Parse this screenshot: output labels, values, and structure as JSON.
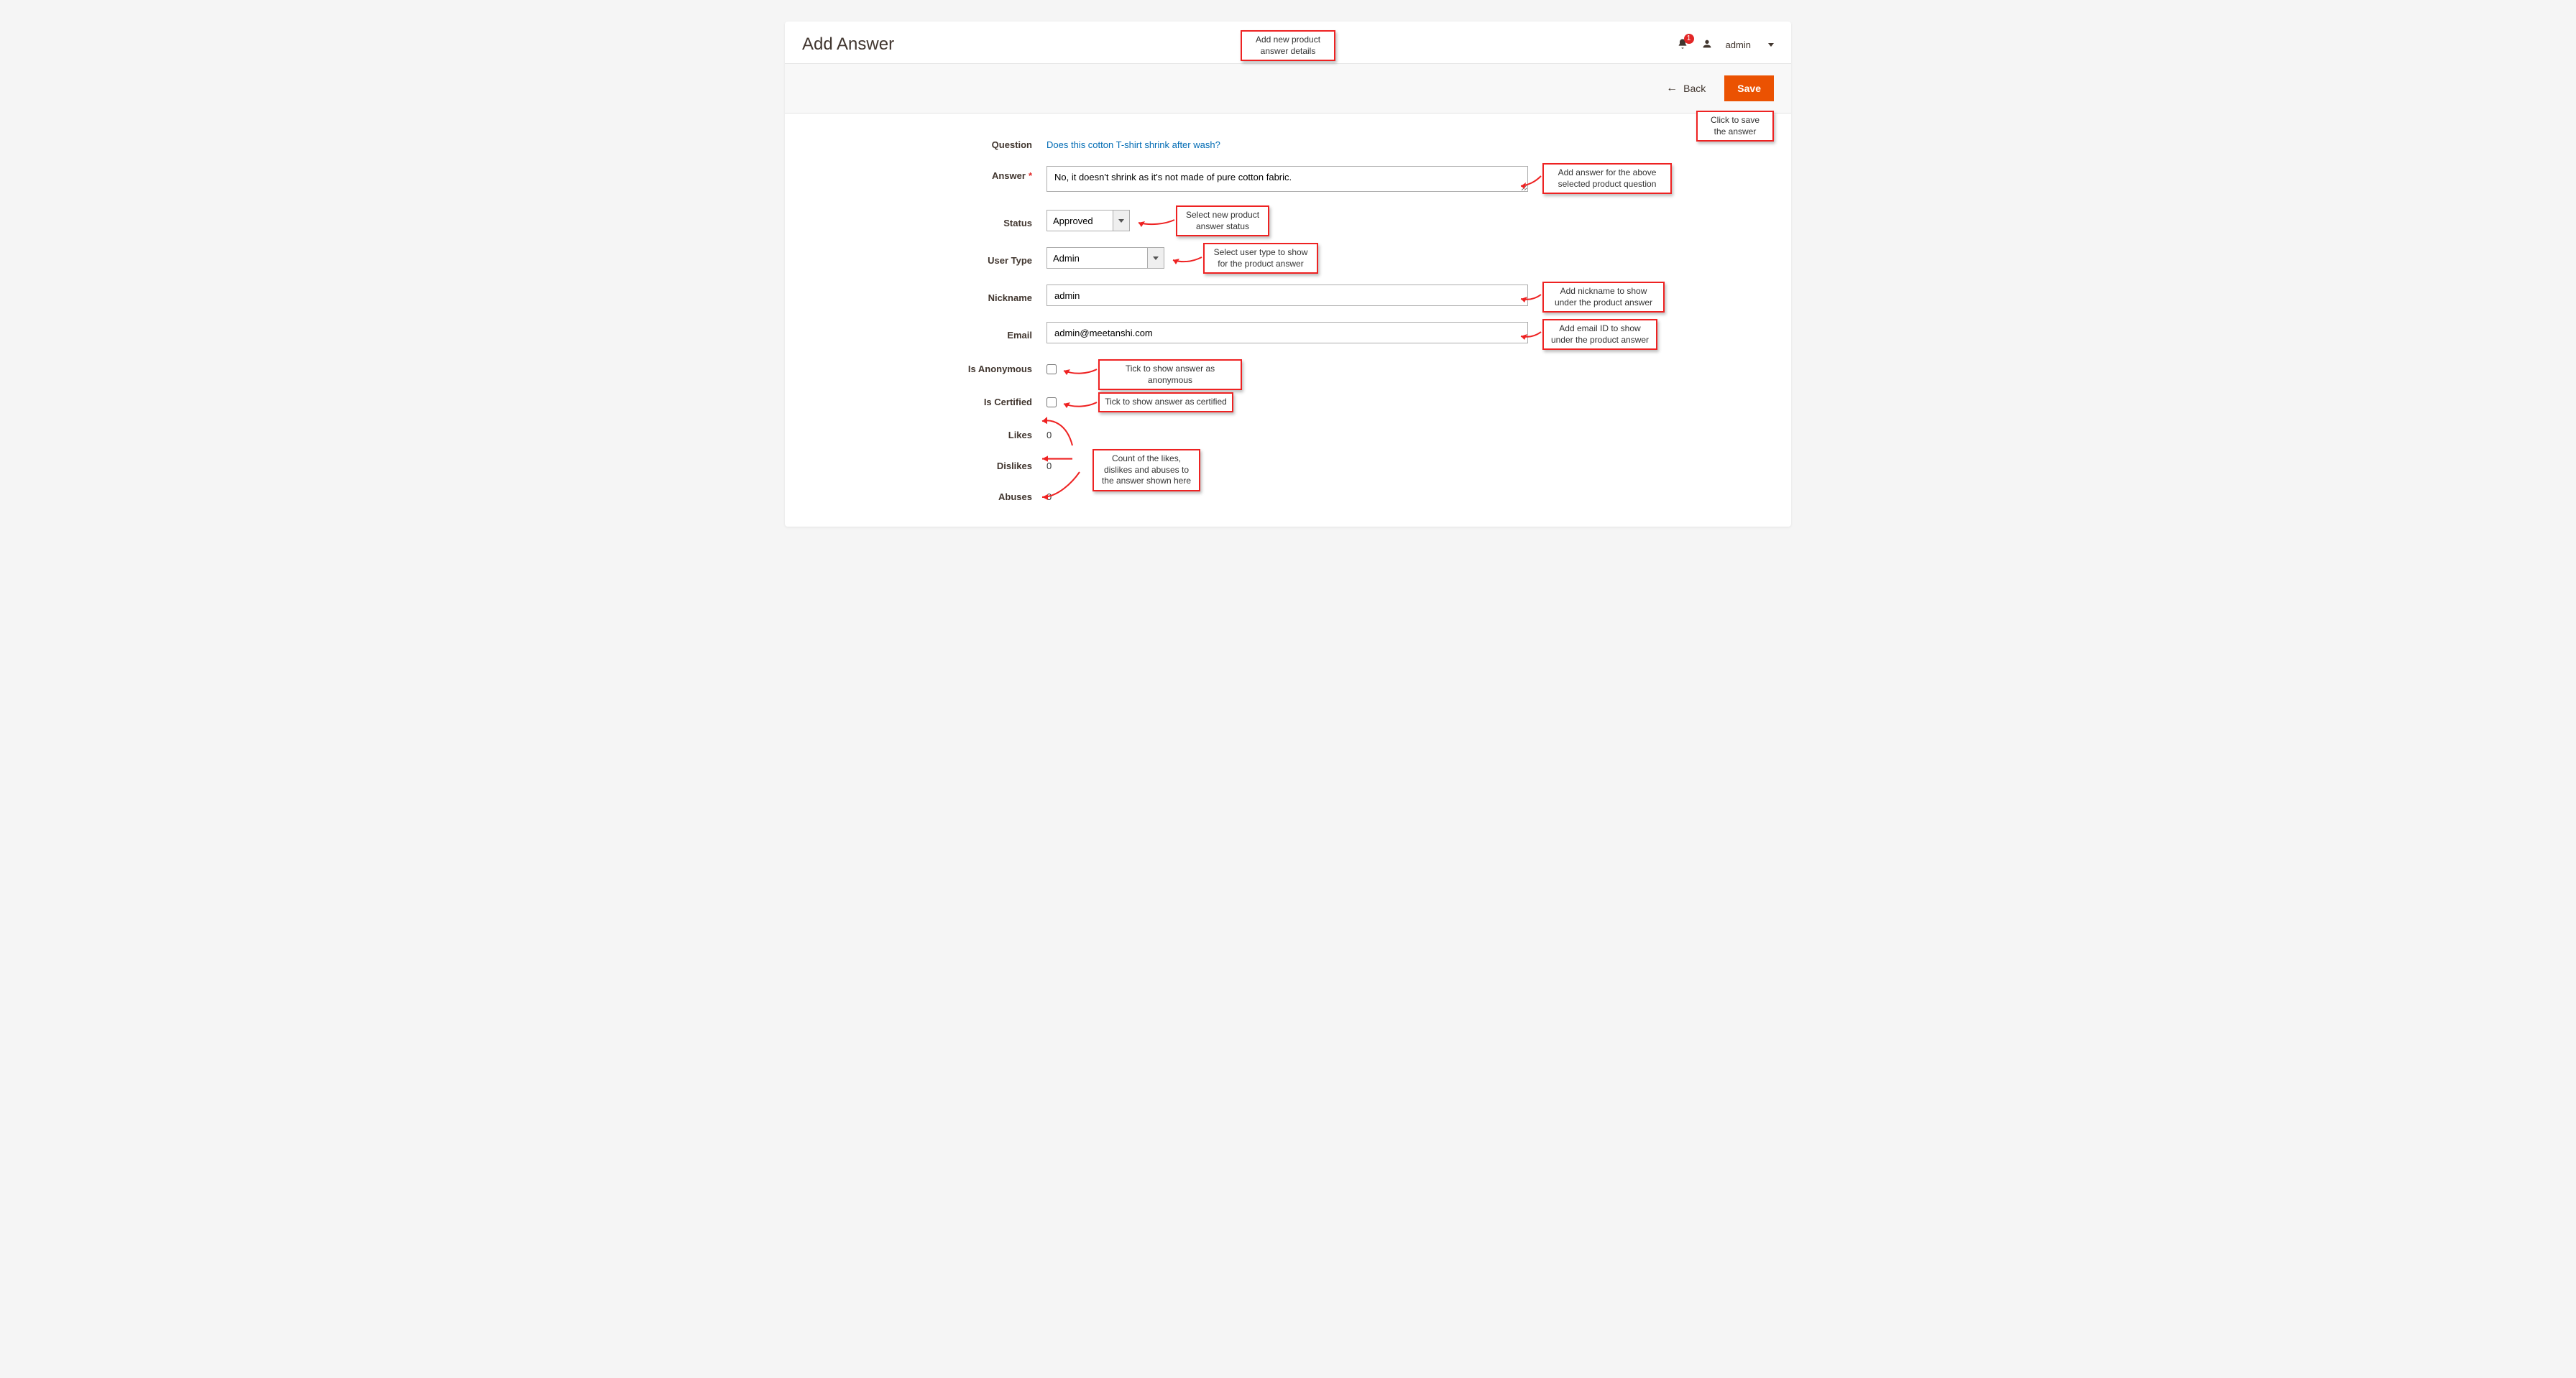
{
  "page_title": "Add Answer",
  "header": {
    "notifications_count": "1",
    "username": "admin"
  },
  "actions": {
    "back_label": "Back",
    "save_label": "Save"
  },
  "labels": {
    "question": "Question",
    "answer": "Answer",
    "status": "Status",
    "user_type": "User Type",
    "nickname": "Nickname",
    "email": "Email",
    "is_anonymous": "Is Anonymous",
    "is_certified": "Is Certified",
    "likes": "Likes",
    "dislikes": "Dislikes",
    "abuses": "Abuses"
  },
  "form": {
    "question_text": "Does this cotton T-shirt shrink after wash?",
    "answer_value": "No, it doesn't shrink as it's not made of pure cotton fabric.",
    "status_value": "Approved",
    "user_type_value": "Admin",
    "nickname_value": "admin",
    "email_value": "admin@meetanshi.com",
    "is_anonymous_checked": false,
    "is_certified_checked": false,
    "likes_value": "0",
    "dislikes_value": "0",
    "abuses_value": "0"
  },
  "callouts": {
    "top": "Add new product answer details",
    "save": "Click to save the answer",
    "answer": "Add answer for the above selected product question",
    "status": "Select new product answer status",
    "usertype": "Select user type to show for the product answer",
    "nickname": "Add nickname to show under the product answer",
    "email": "Add email ID to show under the product answer",
    "anonymous": "Tick to show answer as anonymous",
    "certified": "Tick to show answer as certified",
    "counts": "Count of the likes, dislikes and abuses to the answer shown here"
  }
}
